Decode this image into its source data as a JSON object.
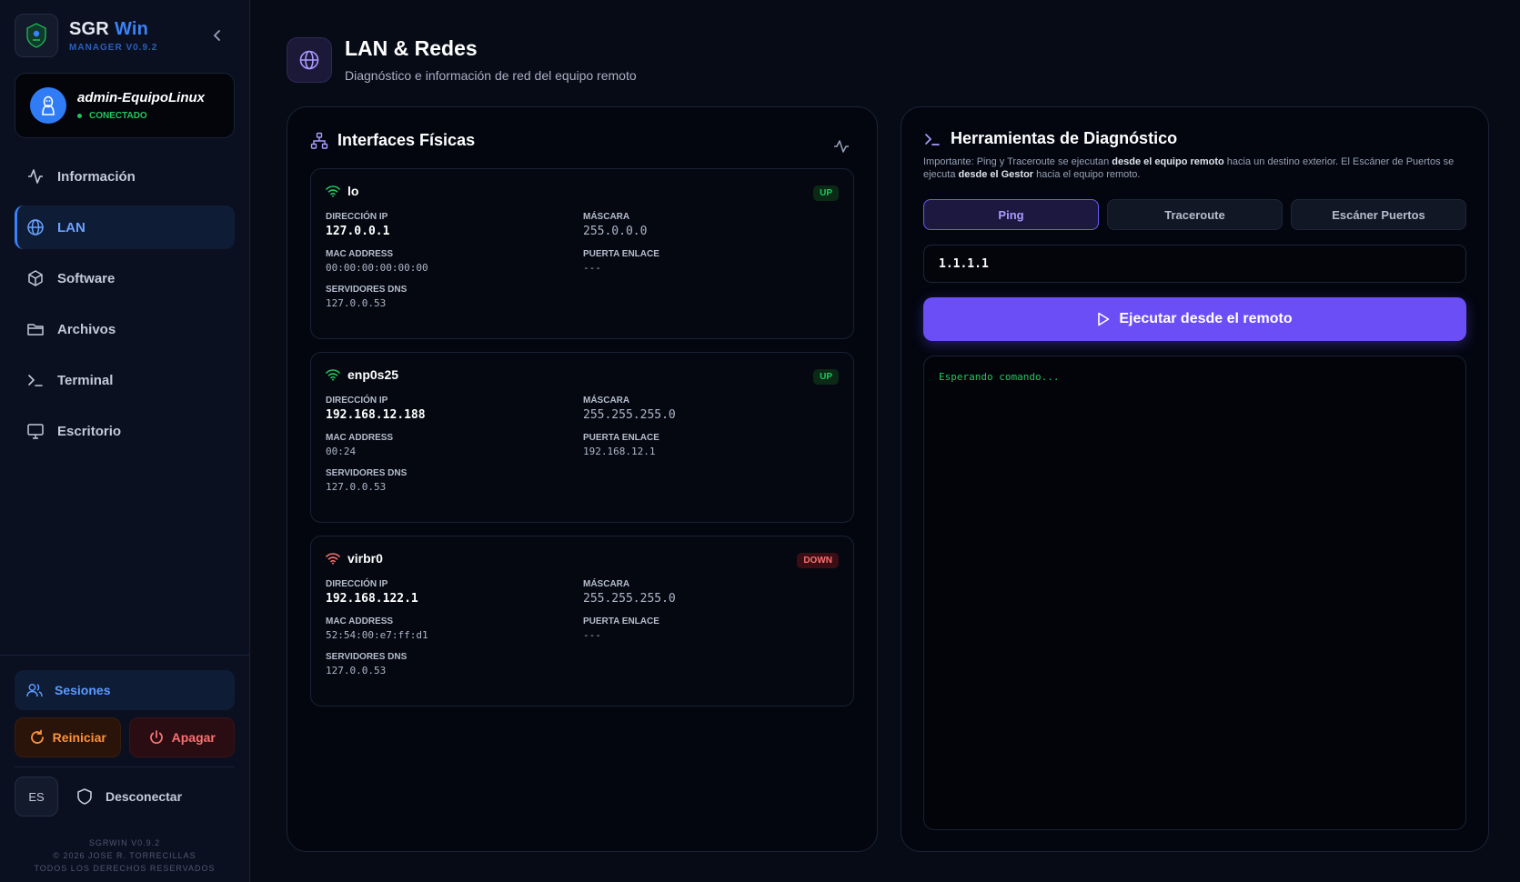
{
  "brand": {
    "name": "SGR",
    "name_accent": "Win",
    "subtitle": "MANAGER V0.9.2"
  },
  "user": {
    "name": "admin-EquipoLinux",
    "status": "CONECTADO"
  },
  "nav": [
    {
      "label": "Información",
      "icon": "activity-icon"
    },
    {
      "label": "LAN",
      "icon": "globe-icon"
    },
    {
      "label": "Software",
      "icon": "package-icon"
    },
    {
      "label": "Archivos",
      "icon": "folder-icon"
    },
    {
      "label": "Terminal",
      "icon": "terminal-icon"
    },
    {
      "label": "Escritorio",
      "icon": "monitor-icon"
    }
  ],
  "bottom": {
    "sessions": "Sesiones",
    "restart": "Reiniciar",
    "shutdown": "Apagar",
    "lang": "ES",
    "disconnect": "Desconectar"
  },
  "footer": {
    "line1": "SGRWIN V0.9.2",
    "line2": "© 2026 JOSE R. TORRECILLAS",
    "line3": "TODOS LOS DERECHOS RESERVADOS"
  },
  "header": {
    "title": "LAN & Redes",
    "subtitle": "Diagnóstico e información de red del equipo remoto"
  },
  "interfaces_panel": {
    "title": "Interfaces Físicas",
    "labels": {
      "ip": "DIRECCIÓN IP",
      "mask": "MÁSCARA",
      "mac": "MAC ADDRESS",
      "gateway": "PUERTA ENLACE",
      "dns": "SERVIDORES DNS"
    },
    "items": [
      {
        "name": "lo",
        "state": "UP",
        "ip": "127.0.0.1",
        "mask": "255.0.0.0",
        "mac": "00:00:00:00:00:00",
        "gateway": "---",
        "dns": "127.0.0.53"
      },
      {
        "name": "enp0s25",
        "state": "UP",
        "ip": "192.168.12.188",
        "mask": "255.255.255.0",
        "mac": "00:24",
        "gateway": "192.168.12.1",
        "dns": "127.0.0.53"
      },
      {
        "name": "virbr0",
        "state": "DOWN",
        "ip": "192.168.122.1",
        "mask": "255.255.255.0",
        "mac": "52:54:00:e7:ff:d1",
        "gateway": "---",
        "dns": "127.0.0.53"
      }
    ]
  },
  "tools": {
    "title": "Herramientas de Diagnóstico",
    "desc_1": "Importante: Ping y Traceroute se ejecutan ",
    "desc_b1": "desde el equipo remoto",
    "desc_2": " hacia un destino exterior. El Escáner de Puertos se ejecuta ",
    "desc_b2": "desde el Gestor",
    "desc_3": " hacia el equipo remoto.",
    "tabs": [
      "Ping",
      "Traceroute",
      "Escáner Puertos"
    ],
    "active_tab": "Ping",
    "target_value": "1.1.1.1",
    "run_label": "Ejecutar desde el remoto",
    "console_text": "Esperando comando..."
  },
  "colors": {
    "accent": "#3b82f6",
    "purple": "#6b4ef6",
    "success": "#22c55e",
    "danger": "#f87171",
    "warning": "#fb923c"
  }
}
